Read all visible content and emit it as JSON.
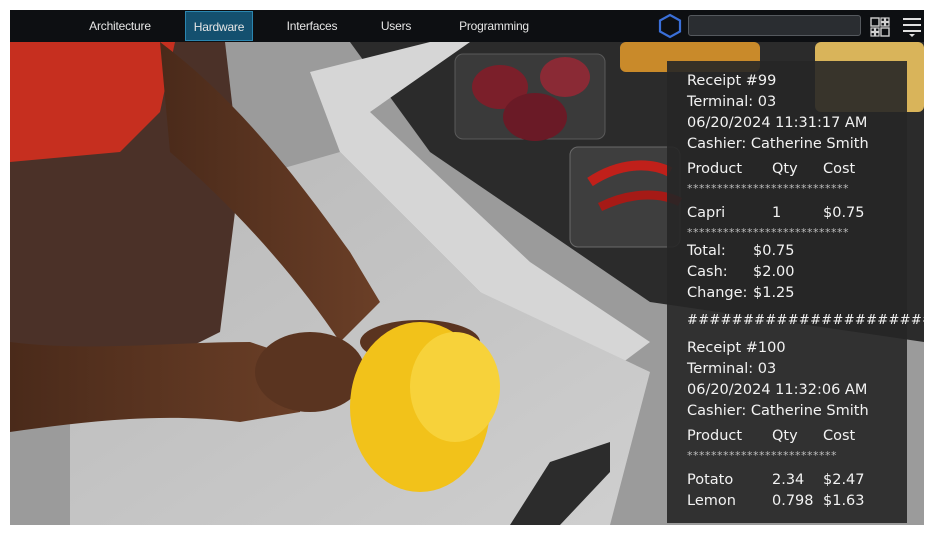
{
  "nav": {
    "items": [
      {
        "label": "Architecture",
        "active": false
      },
      {
        "label": "Hardware",
        "active": true
      },
      {
        "label": "Interfaces",
        "active": false
      },
      {
        "label": "Users",
        "active": false
      },
      {
        "label": "Programming",
        "active": false
      }
    ],
    "icons": [
      "hexagon-logo-icon",
      "grid-view-icon",
      "menu-icon"
    ],
    "search": {
      "value": "",
      "placeholder": ""
    }
  },
  "colors": {
    "nav_bg": "#0d0f12",
    "nav_active": "#14506f",
    "nav_active_border": "#2b86b0",
    "receipt_bg": "#262626",
    "accent_blue": "#3a6fd8"
  },
  "receipts": [
    {
      "header": "Receipt #99",
      "terminal": "Terminal: 03",
      "datetime": "06/20/2024 11:31:17 AM",
      "cashier": "Cashier: Catherine Smith",
      "columns": [
        "Product",
        "Qty",
        "Cost"
      ],
      "separator": "***************************",
      "items": [
        {
          "product": "Capri",
          "qty": "1",
          "cost": "$0.75"
        }
      ],
      "totals": [
        {
          "label": "Total:",
          "value": "$0.75"
        },
        {
          "label": "Cash:",
          "value": "$2.00"
        },
        {
          "label": "Change:",
          "value": "$1.25"
        }
      ]
    },
    {
      "header": "Receipt #100",
      "terminal": "Terminal: 03",
      "datetime": "06/20/2024 11:32:06 AM",
      "cashier": "Cashier: Catherine Smith",
      "columns": [
        "Product",
        "Qty",
        "Cost"
      ],
      "separator": "*************************",
      "items": [
        {
          "product": "Potato",
          "qty": "2.34",
          "cost": "$2.47"
        },
        {
          "product": "Lemon",
          "qty": "0.798",
          "cost": "$1.63"
        }
      ]
    }
  ],
  "divider": "########################"
}
